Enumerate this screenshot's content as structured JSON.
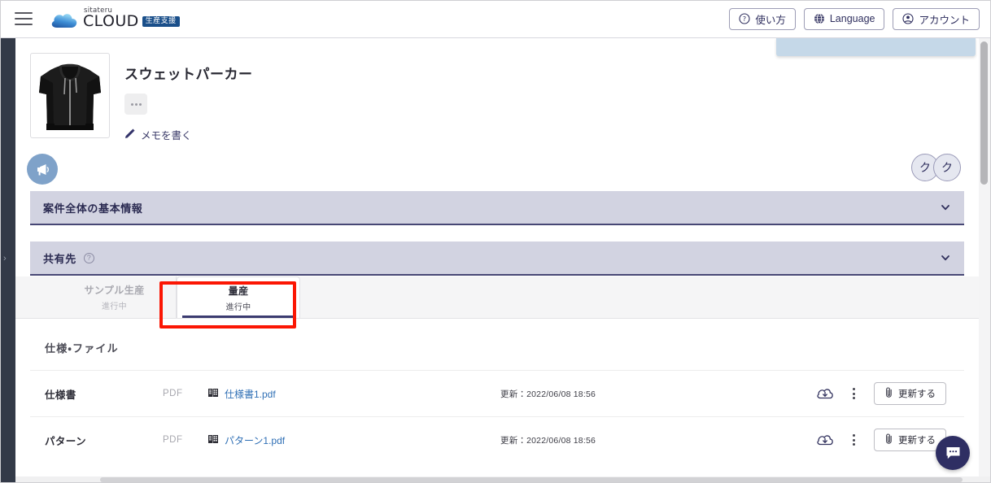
{
  "topbar": {
    "menu_icon": "hamburger-icon",
    "brand": {
      "sub": "sitateru",
      "main": "CLOUD",
      "badge": "生産支援"
    },
    "buttons": [
      {
        "label": "使い方",
        "icon": "question-circle-icon"
      },
      {
        "label": "Language",
        "icon": "globe-icon"
      },
      {
        "label": "アカウント",
        "icon": "account-circle-icon"
      }
    ]
  },
  "leftrail": {
    "expander": "›"
  },
  "product": {
    "title": "スウェットパーカー",
    "thumb_alt": "black-zip-hoodie",
    "more_button": "…",
    "memo_link": "メモを書く",
    "memo_icon": "pencil-icon",
    "announce_icon": "megaphone-icon",
    "avatars": [
      {
        "initial": "ク"
      },
      {
        "initial": "ク"
      }
    ]
  },
  "accordions": [
    {
      "title": "案件全体の基本情報",
      "help": false,
      "chevron": "chevron-down-icon"
    },
    {
      "title": "共有先",
      "help": true,
      "help_glyph": "?",
      "chevron": "chevron-down-icon"
    }
  ],
  "tabs": [
    {
      "name": "サンプル生産",
      "state": "進行中",
      "active": false
    },
    {
      "name": "量産",
      "state": "進行中",
      "active": true
    }
  ],
  "files": {
    "section_title": "仕様・ファイル",
    "rows": [
      {
        "label": "仕様書",
        "type": "PDF",
        "filename": "仕様書1.pdf",
        "file_icon": "document-grid-icon",
        "updated": "更新：2022/06/08 18:56",
        "download_icon": "cloud-download-icon",
        "menu_icon": "kebab-menu-icon",
        "update_label": "更新する",
        "update_icon": "paperclip-icon"
      },
      {
        "label": "パターン",
        "type": "PDF",
        "filename": "パターン1.pdf",
        "file_icon": "document-grid-icon",
        "updated": "更新：2022/06/08 18:56",
        "download_icon": "cloud-download-icon",
        "menu_icon": "kebab-menu-icon",
        "update_label": "更新する",
        "update_icon": "paperclip-icon"
      }
    ]
  },
  "chat": {
    "icon": "chat-bubble-icon"
  },
  "colors": {
    "brand_badge": "#1a4f8a",
    "accordion_bg": "#d2d3e1",
    "accordion_border": "#474775",
    "accent_navy": "#2e2e63",
    "annotation_red": "#fb1603",
    "link_blue": "#2f6fb5",
    "rail_dark": "#333a48",
    "megaphone_bg": "#7fa2c9"
  }
}
